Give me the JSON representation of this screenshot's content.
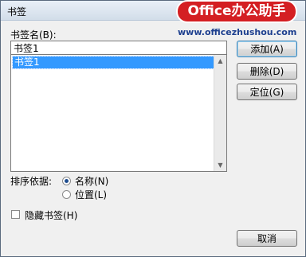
{
  "window": {
    "title": "书签"
  },
  "watermark": {
    "brand": "Office办公助手",
    "url": "www.officezhushou.com"
  },
  "bookmark": {
    "name_label": "书签名(B):",
    "name_value": "书签1",
    "list_items": [
      "书签1"
    ]
  },
  "buttons": {
    "add": "添加(A)",
    "delete": "删除(D)",
    "goto": "定位(G)",
    "cancel": "取消"
  },
  "sort": {
    "label": "排序依据:",
    "options": [
      {
        "label": "名称(N)",
        "checked": true
      },
      {
        "label": "位置(L)",
        "checked": false
      }
    ]
  },
  "hidden_bookmarks": {
    "label": "隐藏书签(H)",
    "checked": false
  },
  "colors": {
    "selection": "#3399ff",
    "watermark": "#d41f23"
  }
}
